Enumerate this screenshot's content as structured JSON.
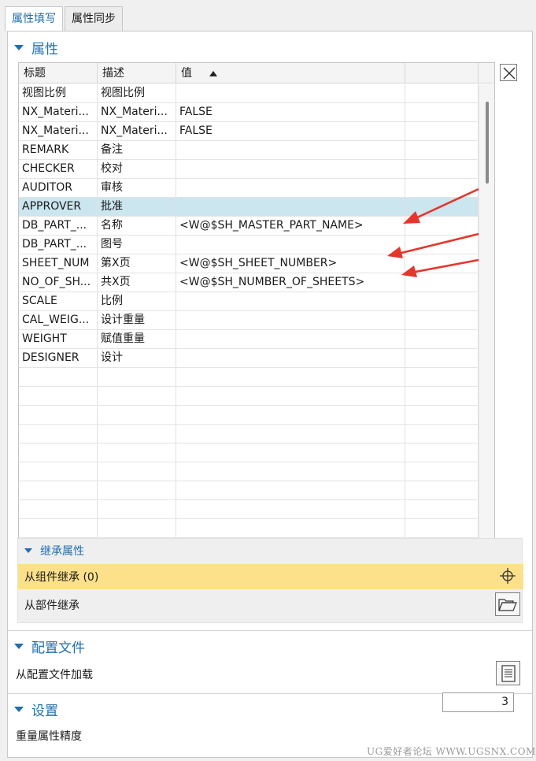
{
  "tabs": [
    "属性填写",
    "属性同步"
  ],
  "sections": {
    "attributes": "属性",
    "inherit": "继承属性",
    "config": "配置文件",
    "settings": "设置"
  },
  "grid": {
    "headers": [
      "标题",
      "描述",
      "值",
      ""
    ],
    "rows": [
      {
        "title": "视图比例",
        "desc": "视图比例",
        "value": ""
      },
      {
        "title": "NX_Materi...",
        "desc": "NX_Materi...",
        "value": "FALSE"
      },
      {
        "title": "NX_Materi...",
        "desc": "NX_Materi...",
        "value": "FALSE"
      },
      {
        "title": "REMARK",
        "desc": "备注",
        "value": ""
      },
      {
        "title": "CHECKER",
        "desc": "校对",
        "value": ""
      },
      {
        "title": "AUDITOR",
        "desc": "审核",
        "value": ""
      },
      {
        "title": "APPROVER",
        "desc": "批准",
        "value": ""
      },
      {
        "title": "DB_PART_...",
        "desc": "名称",
        "value": "<W@$SH_MASTER_PART_NAME>"
      },
      {
        "title": "DB_PART_...",
        "desc": "图号",
        "value": ""
      },
      {
        "title": "SHEET_NUM",
        "desc": "第X页",
        "value": "<W@$SH_SHEET_NUMBER>"
      },
      {
        "title": "NO_OF_SH...",
        "desc": "共X页",
        "value": "<W@$SH_NUMBER_OF_SHEETS>"
      },
      {
        "title": "SCALE",
        "desc": "比例",
        "value": ""
      },
      {
        "title": "CAL_WEIG...",
        "desc": "设计重量",
        "value": ""
      },
      {
        "title": "WEIGHT",
        "desc": "赋值重量",
        "value": ""
      },
      {
        "title": "DESIGNER",
        "desc": "设计",
        "value": ""
      },
      {
        "title": "",
        "desc": "",
        "value": ""
      },
      {
        "title": "",
        "desc": "",
        "value": ""
      },
      {
        "title": "",
        "desc": "",
        "value": ""
      },
      {
        "title": "",
        "desc": "",
        "value": ""
      },
      {
        "title": "",
        "desc": "",
        "value": ""
      },
      {
        "title": "",
        "desc": "",
        "value": ""
      },
      {
        "title": "",
        "desc": "",
        "value": ""
      },
      {
        "title": "",
        "desc": "",
        "value": ""
      },
      {
        "title": "",
        "desc": "",
        "value": ""
      },
      {
        "title": "",
        "desc": "",
        "value": ""
      }
    ],
    "selected_row": 6
  },
  "inherit": {
    "from_component": "从组件继承 (0)",
    "from_part": "从部件继承"
  },
  "config": {
    "load_label": "从配置文件加载"
  },
  "settings": {
    "precision_label": "重量属性精度",
    "precision_value": "3"
  },
  "watermark": "UG爱好者论坛 WWW.UGSNX.COM",
  "colors": {
    "accent": "#1f6fb2",
    "selected_row": "#cbe6ee",
    "highlight": "#fde18a",
    "annotation_arrow": "#e8342a"
  }
}
